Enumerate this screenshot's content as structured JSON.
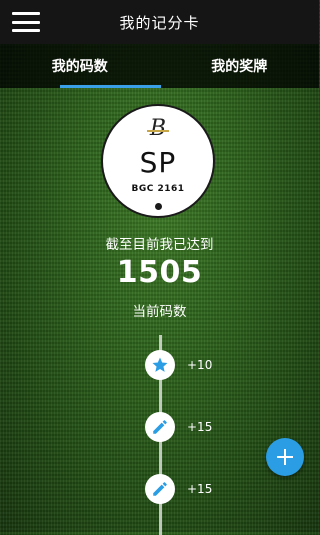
{
  "header": {
    "title": "我的记分卡"
  },
  "tabs": [
    {
      "label": "我的码数",
      "active": true
    },
    {
      "label": "我的奖牌",
      "active": false
    }
  ],
  "profile": {
    "logo_letter": "B",
    "initials": "SP",
    "club": "BGC 2161"
  },
  "summary": {
    "caption": "截至目前我已达到",
    "points": "1505",
    "points_label": "当前码数"
  },
  "timeline": [
    {
      "icon": "star-icon",
      "delta": "+10"
    },
    {
      "icon": "pencil-icon",
      "delta": "+15"
    },
    {
      "icon": "pencil-icon",
      "delta": "+15"
    }
  ],
  "colors": {
    "accent": "#2a9de4",
    "tab_indicator": "#3aa0e8"
  }
}
